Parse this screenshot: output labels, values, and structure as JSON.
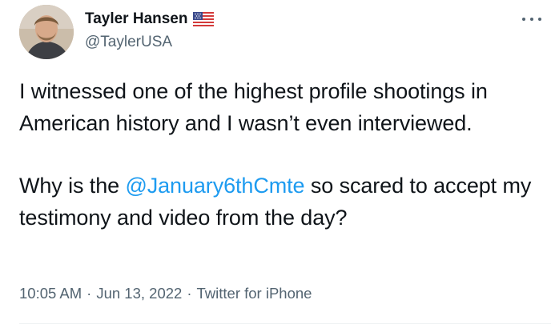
{
  "user": {
    "display_name": "Tayler Hansen",
    "handle": "@TaylerUSA",
    "badge_icon": "us-flag-icon"
  },
  "more_menu": {
    "icon": "more-dots-icon"
  },
  "tweet": {
    "paragraph1": "I witnessed one of the highest profile shootings in American history and I wasn’t even interviewed.",
    "p2_before": "Why is the ",
    "mention": "@January6thCmte",
    "p2_after": " so scared to accept my testimony and video from the day?"
  },
  "meta": {
    "time": "10:05 AM",
    "separator": "·",
    "date": "Jun 13, 2022",
    "source": "Twitter for iPhone"
  },
  "colors": {
    "text": "#0f1419",
    "secondary": "#536471",
    "link": "#1d9bf0",
    "divider": "#eff3f4"
  }
}
